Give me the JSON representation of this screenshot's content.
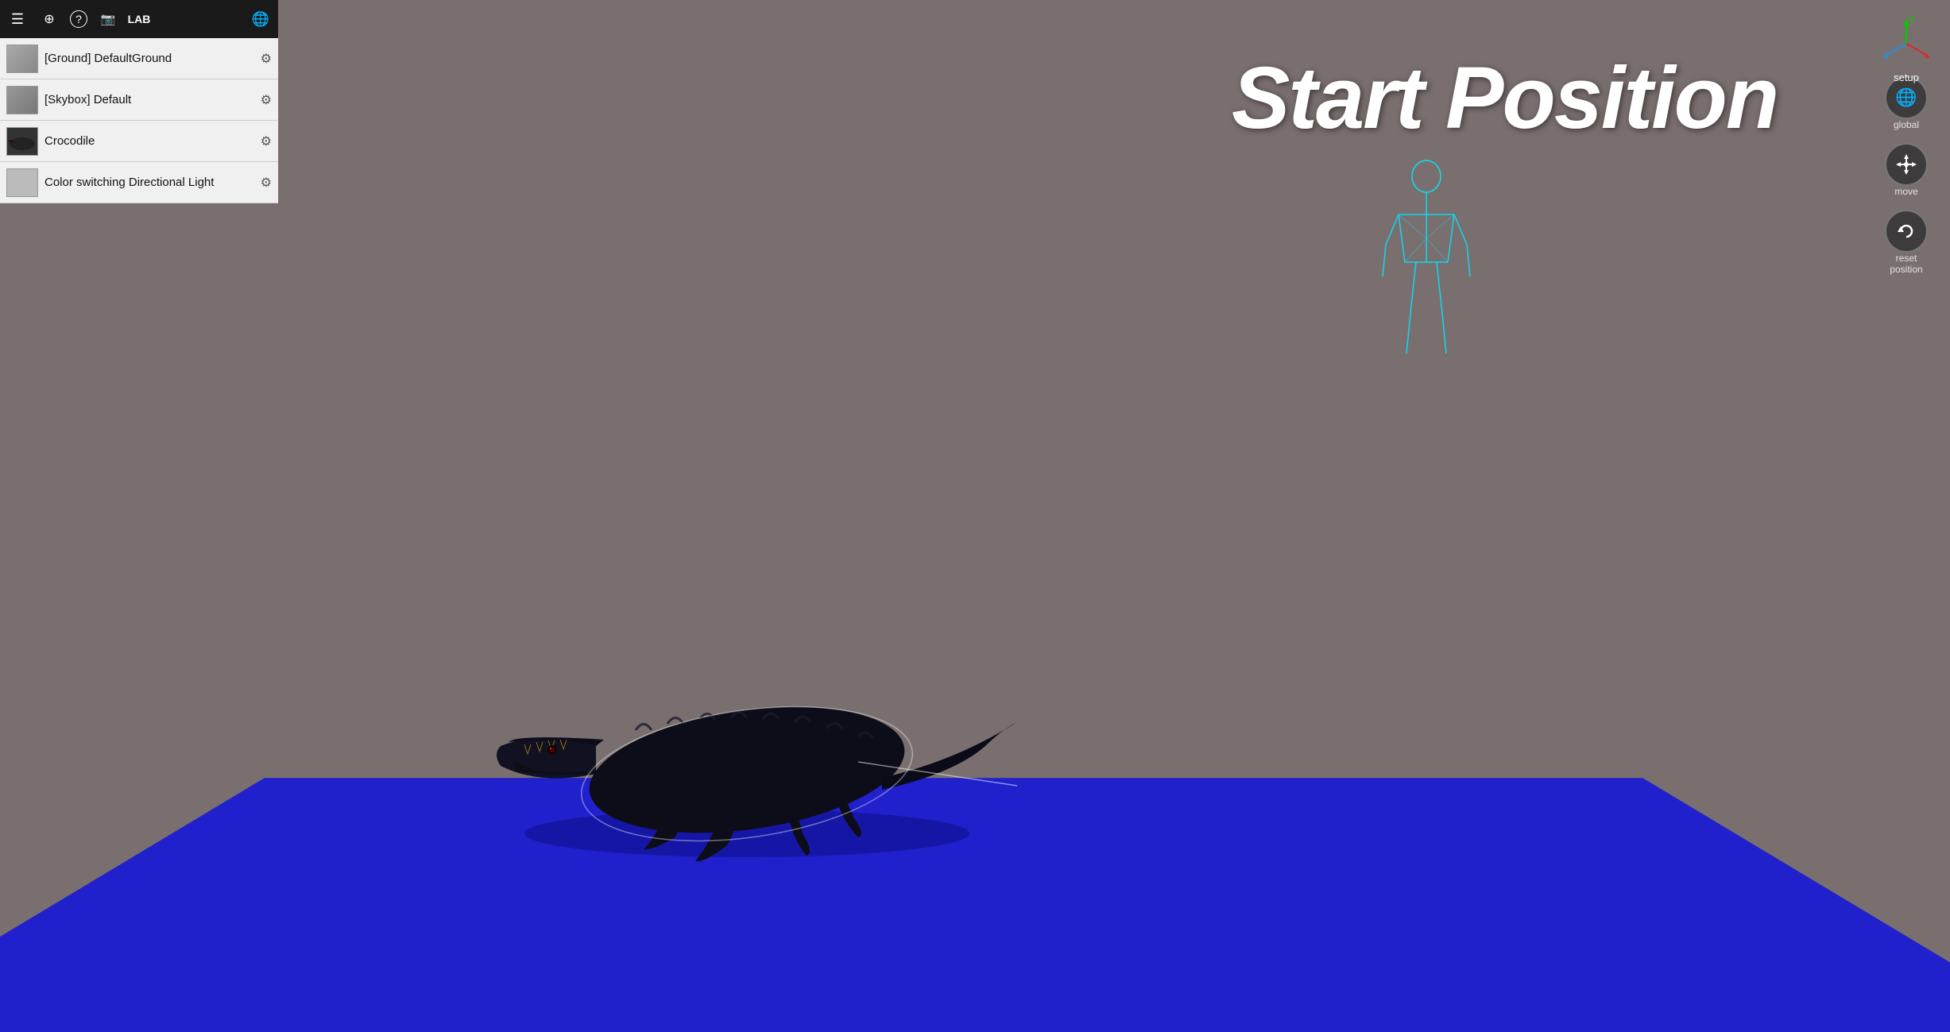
{
  "toolbar": {
    "title": "LAB",
    "icons": [
      {
        "name": "menu-icon",
        "symbol": "☰"
      },
      {
        "name": "add-scene-icon",
        "symbol": "⊞"
      },
      {
        "name": "help-icon",
        "symbol": "?"
      },
      {
        "name": "camera-icon",
        "symbol": "🎥"
      },
      {
        "name": "globe-icon",
        "symbol": "🌐"
      }
    ]
  },
  "scene_panel": {
    "items": [
      {
        "id": "ground",
        "label": "[Ground] DefaultGround",
        "thumb_type": "ground"
      },
      {
        "id": "skybox",
        "label": "[Skybox] Default",
        "thumb_type": "skybox"
      },
      {
        "id": "crocodile",
        "label": "Crocodile",
        "thumb_type": "croc"
      },
      {
        "id": "directional-light",
        "label": "Color switching Directional Light",
        "thumb_type": "light"
      }
    ]
  },
  "viewport": {
    "start_position_text": "Start Position"
  },
  "right_controls": {
    "setup_label": "setup",
    "global_label": "global",
    "move_label": "move",
    "reset_position_label": "reset position"
  },
  "colors": {
    "floor": "#2525dd",
    "background": "#7a6f6f",
    "toolbar_bg": "#1a1a1a",
    "cyan_figure": "#00e5ff"
  }
}
